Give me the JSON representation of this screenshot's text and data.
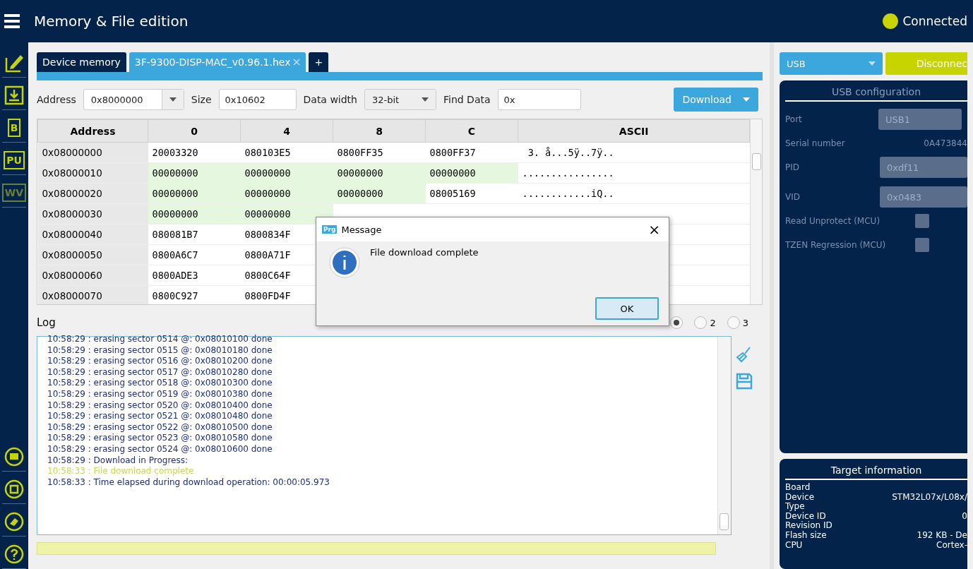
{
  "header": {
    "title": "Memory & File edition",
    "status": "Connected"
  },
  "sidebar": {
    "items": [
      {
        "kind": "edit",
        "selected": false
      },
      {
        "kind": "download",
        "selected": false
      },
      {
        "kind": "text",
        "label": "B",
        "selected": false
      },
      {
        "kind": "text",
        "label": "PU",
        "selected": false
      },
      {
        "kind": "text",
        "label": "WV",
        "selected": false,
        "disabled": true
      },
      {
        "kind": "beta",
        "selected": false
      },
      {
        "kind": "chip",
        "selected": false
      },
      {
        "kind": "erase",
        "selected": false
      },
      {
        "kind": "help",
        "selected": false
      }
    ]
  },
  "tabs": [
    {
      "label": "Device memory",
      "selected": false,
      "closable": false
    },
    {
      "label": "3F-9300-DISP-MAC_v0.96.1.hex",
      "selected": true,
      "closable": true
    },
    {
      "label": "+",
      "selected": false,
      "closable": false
    }
  ],
  "toolbar": {
    "address_label": "Address",
    "address": "0x8000000",
    "size_label": "Size",
    "size": "0x10602",
    "width_label": "Data width",
    "width": "32-bit",
    "find_label": "Find Data",
    "find": "0x",
    "action": "Download"
  },
  "table": {
    "columns": [
      "Address",
      "0",
      "4",
      "8",
      "C",
      "ASCII"
    ],
    "rows": [
      {
        "cells": [
          {
            "kind": "address",
            "text": "0x08000000"
          },
          {
            "kind": "hex",
            "text": "20003320",
            "highlighted": false
          },
          {
            "kind": "hex",
            "text": "080103E5",
            "highlighted": false
          },
          {
            "kind": "hex",
            "text": "0800FF35",
            "highlighted": false
          },
          {
            "kind": "hex",
            "text": "0800FF37",
            "highlighted": false
          },
          {
            "kind": "ascii",
            "text": " 3. å...5ÿ..7ÿ.."
          }
        ]
      },
      {
        "cells": [
          {
            "kind": "address",
            "text": "0x08000010"
          },
          {
            "kind": "hex",
            "text": "00000000",
            "highlighted": true
          },
          {
            "kind": "hex",
            "text": "00000000",
            "highlighted": true
          },
          {
            "kind": "hex",
            "text": "00000000",
            "highlighted": true
          },
          {
            "kind": "hex",
            "text": "00000000",
            "highlighted": true
          },
          {
            "kind": "ascii",
            "text": "................"
          }
        ]
      },
      {
        "cells": [
          {
            "kind": "address",
            "text": "0x08000020"
          },
          {
            "kind": "hex",
            "text": "00000000",
            "highlighted": true
          },
          {
            "kind": "hex",
            "text": "00000000",
            "highlighted": true
          },
          {
            "kind": "hex",
            "text": "00000000",
            "highlighted": true
          },
          {
            "kind": "hex",
            "text": "08005169",
            "highlighted": false
          },
          {
            "kind": "ascii",
            "text": "............iQ.."
          }
        ]
      },
      {
        "cells": [
          {
            "kind": "address",
            "text": "0x08000030"
          },
          {
            "kind": "hex",
            "text": "00000000",
            "highlighted": true
          },
          {
            "kind": "hex",
            "text": "00000000",
            "highlighted": true
          }
        ]
      },
      {
        "cells": [
          {
            "kind": "address",
            "text": "0x08000040"
          },
          {
            "kind": "hex",
            "text": "080081B7",
            "highlighted": false
          },
          {
            "kind": "hex",
            "text": "0800834F",
            "highlighted": false
          }
        ]
      },
      {
        "cells": [
          {
            "kind": "address",
            "text": "0x08000050"
          },
          {
            "kind": "hex",
            "text": "0800A6C7",
            "highlighted": false
          },
          {
            "kind": "hex",
            "text": "0800A71F",
            "highlighted": false
          }
        ]
      },
      {
        "cells": [
          {
            "kind": "address",
            "text": "0x08000060"
          },
          {
            "kind": "hex",
            "text": "0800ADE3",
            "highlighted": false
          },
          {
            "kind": "hex",
            "text": "0800C64F",
            "highlighted": false
          }
        ]
      },
      {
        "cells": [
          {
            "kind": "address",
            "text": "0x08000070"
          },
          {
            "kind": "hex",
            "text": "0800C927",
            "highlighted": false
          },
          {
            "kind": "hex",
            "text": "0800FD4F",
            "highlighted": false
          }
        ]
      }
    ]
  },
  "log": {
    "title": "Log",
    "verbosity": [
      {
        "selected": true
      },
      {
        "label": "2",
        "selected": false
      },
      {
        "label": "3",
        "selected": false
      }
    ],
    "lines": [
      {
        "kind": "info",
        "text": "10:58:29 : erasing sector 0514 @: 0x08010100 done"
      },
      {
        "kind": "info",
        "text": "10:58:29 : erasing sector 0515 @: 0x08010180 done"
      },
      {
        "kind": "info",
        "text": "10:58:29 : erasing sector 0516 @: 0x08010200 done"
      },
      {
        "kind": "info",
        "text": "10:58:29 : erasing sector 0517 @: 0x08010280 done"
      },
      {
        "kind": "info",
        "text": "10:58:29 : erasing sector 0518 @: 0x08010300 done"
      },
      {
        "kind": "info",
        "text": "10:58:29 : erasing sector 0519 @: 0x08010380 done"
      },
      {
        "kind": "info",
        "text": "10:58:29 : erasing sector 0520 @: 0x08010400 done"
      },
      {
        "kind": "info",
        "text": "10:58:29 : erasing sector 0521 @: 0x08010480 done"
      },
      {
        "kind": "info",
        "text": "10:58:29 : erasing sector 0522 @: 0x08010500 done"
      },
      {
        "kind": "info",
        "text": "10:58:29 : erasing sector 0523 @: 0x08010580 done"
      },
      {
        "kind": "info",
        "text": "10:58:29 : erasing sector 0524 @: 0x08010600 done"
      },
      {
        "kind": "info",
        "text": "10:58:29 : Download in Progress:"
      },
      {
        "kind": "success",
        "text": "10:58:33 : File download complete"
      },
      {
        "kind": "info",
        "text": "10:58:33 : Time elapsed during download operation: 00:00:05.973"
      }
    ]
  },
  "progress": {
    "level": 1
  },
  "connection": {
    "interface": "USB",
    "action": "Disconnec"
  },
  "usb_config": {
    "title": "USB configuration",
    "port_label": "Port",
    "port": "USB1",
    "serial_label": "Serial number",
    "serial": "0A473844",
    "pid_label": "PID",
    "pid": "0xdf11",
    "vid_label": "VID",
    "vid": "0x0483",
    "options": [
      {
        "label": "Read Unprotect (MCU)",
        "checked": false
      },
      {
        "label": "TZEN Regression (MCU)",
        "checked": false
      }
    ]
  },
  "target": {
    "title": "Target information",
    "rows": [
      {
        "label": "Board"
      },
      {
        "label": "Device",
        "value": "STM32L07x/L08x/"
      },
      {
        "label": "Type"
      },
      {
        "label": "Device ID",
        "value": "0"
      },
      {
        "label": "Revision ID"
      },
      {
        "label": "Flash size",
        "value": "192 KB - De"
      },
      {
        "label": "CPU",
        "value": "Cortex-"
      }
    ]
  },
  "dialog": {
    "title": "Message",
    "app_badge": "Prg",
    "message": "File download complete",
    "button": "OK",
    "close": "×"
  }
}
